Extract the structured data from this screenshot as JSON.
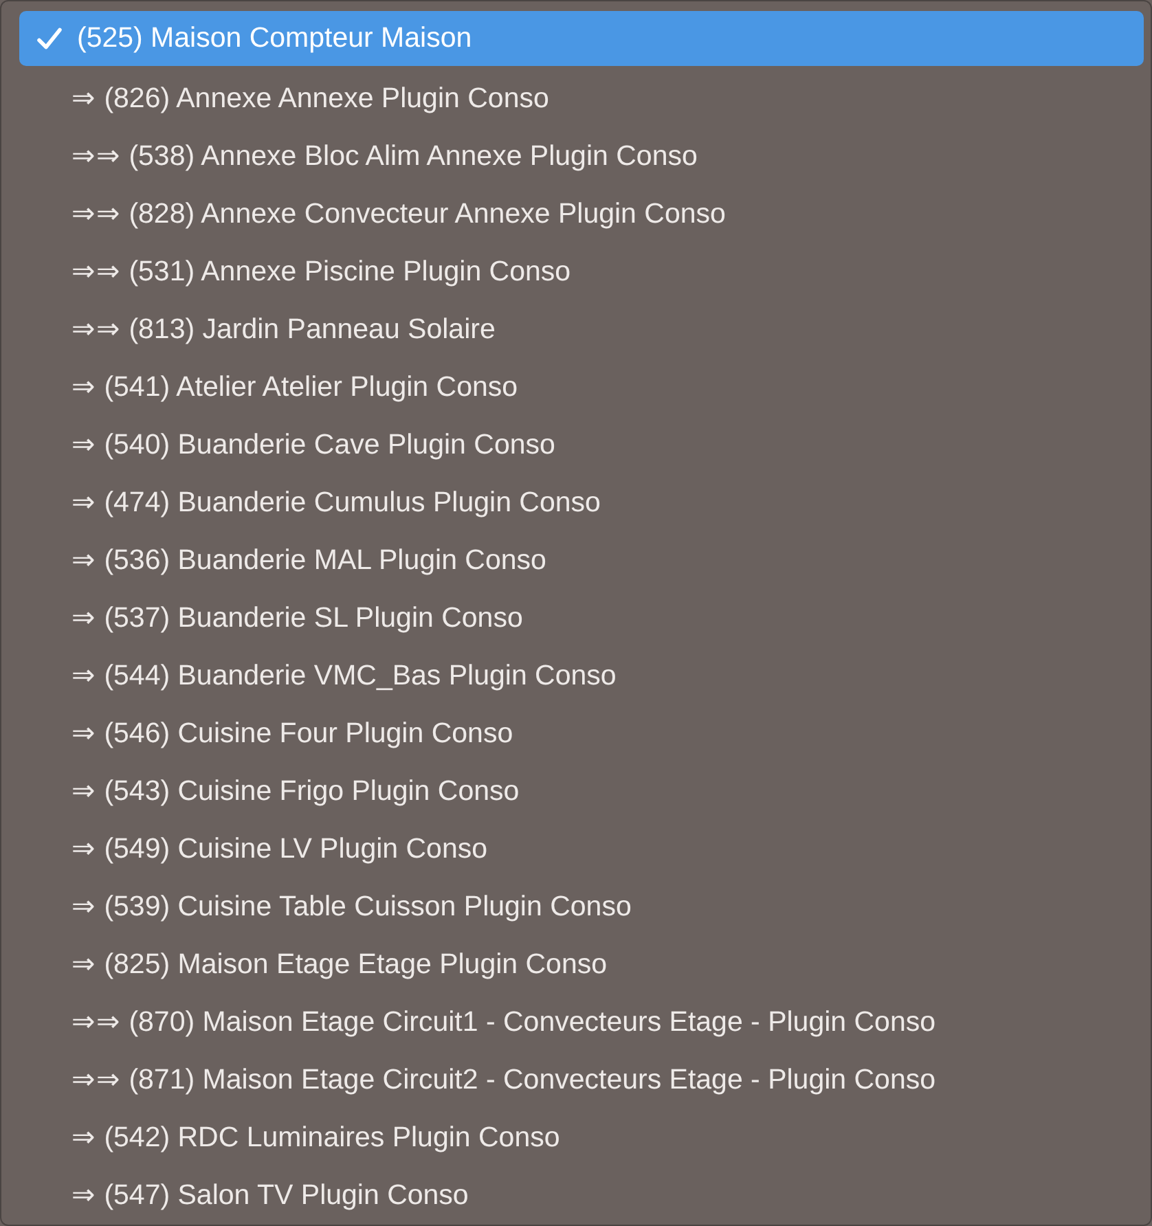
{
  "menu": {
    "items": [
      {
        "label": "(525) Maison Compteur Maison",
        "selected": true
      },
      {
        "label": "⇒ (826) Annexe Annexe Plugin Conso",
        "selected": false
      },
      {
        "label": "⇒⇒ (538) Annexe Bloc Alim Annexe Plugin Conso",
        "selected": false
      },
      {
        "label": "⇒⇒ (828) Annexe Convecteur Annexe Plugin Conso",
        "selected": false
      },
      {
        "label": "⇒⇒ (531) Annexe Piscine Plugin Conso",
        "selected": false
      },
      {
        "label": "⇒⇒ (813) Jardin Panneau Solaire",
        "selected": false
      },
      {
        "label": "⇒ (541) Atelier Atelier Plugin Conso",
        "selected": false
      },
      {
        "label": "⇒ (540) Buanderie Cave Plugin Conso",
        "selected": false
      },
      {
        "label": "⇒ (474) Buanderie Cumulus Plugin Conso",
        "selected": false
      },
      {
        "label": "⇒ (536) Buanderie MAL Plugin Conso",
        "selected": false
      },
      {
        "label": "⇒ (537) Buanderie SL Plugin Conso",
        "selected": false
      },
      {
        "label": "⇒ (544) Buanderie VMC_Bas Plugin Conso",
        "selected": false
      },
      {
        "label": "⇒ (546) Cuisine Four Plugin Conso",
        "selected": false
      },
      {
        "label": "⇒ (543) Cuisine Frigo Plugin Conso",
        "selected": false
      },
      {
        "label": "⇒ (549) Cuisine LV Plugin Conso",
        "selected": false
      },
      {
        "label": "⇒ (539) Cuisine Table Cuisson Plugin Conso",
        "selected": false
      },
      {
        "label": "⇒ (825) Maison Etage Etage Plugin Conso",
        "selected": false
      },
      {
        "label": "⇒⇒ (870) Maison Etage Circuit1 - Convecteurs Etage - Plugin Conso",
        "selected": false
      },
      {
        "label": "⇒⇒ (871) Maison Etage Circuit2 - Convecteurs Etage - Plugin Conso",
        "selected": false
      },
      {
        "label": "⇒ (542) RDC Luminaires Plugin Conso",
        "selected": false
      },
      {
        "label": "⇒ (547) Salon TV Plugin Conso",
        "selected": false
      }
    ]
  }
}
